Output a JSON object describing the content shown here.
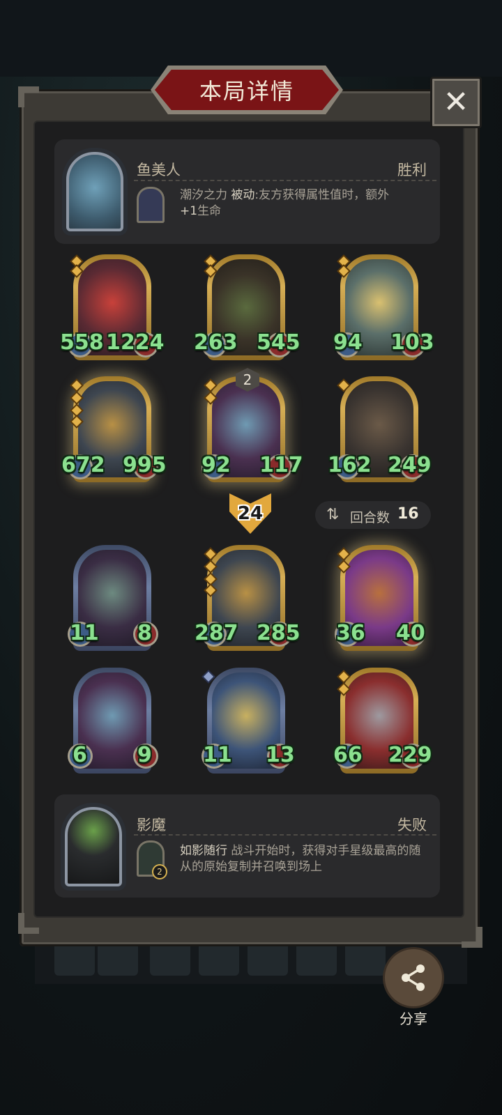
{
  "header": {
    "title": "本局详情",
    "close_label": "✕"
  },
  "player": {
    "name": "鱼美人",
    "result": "胜利",
    "skill_name": "潮汐之力",
    "skill_type": "被动",
    "skill_desc": ":友方获得属性值时，额外",
    "skill_desc_kw": "+1",
    "skill_desc_tail": "生命"
  },
  "player_board": [
    {
      "atk": "558",
      "hp": "1224"
    },
    {
      "atk": "263",
      "hp": "545"
    },
    {
      "atk": "94",
      "hp": "103"
    },
    {
      "atk": "672",
      "hp": "995"
    },
    {
      "atk": "92",
      "hp": "117"
    },
    {
      "atk": "162",
      "hp": "249"
    }
  ],
  "middle": {
    "damage": "24",
    "round_label": "回合数",
    "round_value": "16",
    "level_badge": "2"
  },
  "opponent_board": [
    {
      "atk": "11",
      "hp": "8"
    },
    {
      "atk": "287",
      "hp": "285"
    },
    {
      "atk": "36",
      "hp": "40"
    },
    {
      "atk": "6",
      "hp": "9"
    },
    {
      "atk": "11",
      "hp": "13"
    },
    {
      "atk": "66",
      "hp": "229"
    }
  ],
  "opponent": {
    "name": "影魔",
    "result": "失败",
    "skill_name": "如影随行",
    "skill_desc": "战斗开始时，获得对手星级最高的随从的原始复制并召唤到场上",
    "skill_level": "2"
  },
  "share": {
    "label": "分享"
  },
  "colors": {
    "stat_green": "#8be08f",
    "title_red": "#7a1416",
    "gold_frame": "#d6ae55"
  }
}
